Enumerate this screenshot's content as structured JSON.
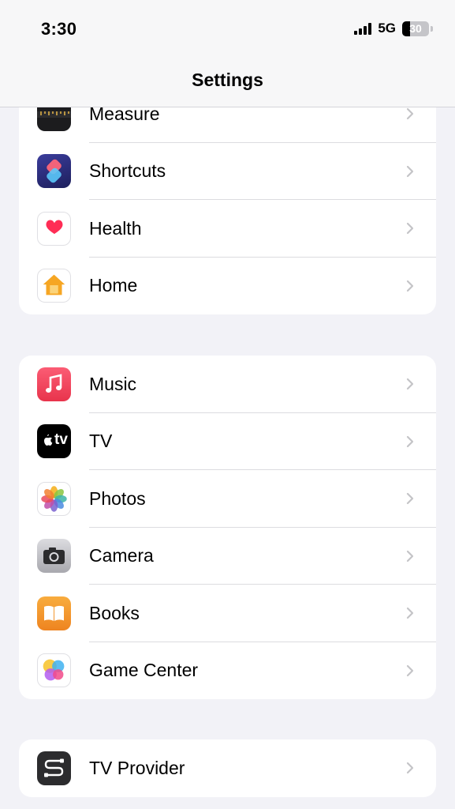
{
  "status_bar": {
    "time": "3:30",
    "network": "5G",
    "battery": "30",
    "battery_level": 0.3
  },
  "header": {
    "title": "Settings"
  },
  "groups": [
    {
      "items": [
        {
          "label": "Measure",
          "icon": "measure-icon"
        },
        {
          "label": "Shortcuts",
          "icon": "shortcuts-icon"
        },
        {
          "label": "Health",
          "icon": "health-icon"
        },
        {
          "label": "Home",
          "icon": "home-icon"
        }
      ]
    },
    {
      "items": [
        {
          "label": "Music",
          "icon": "music-icon"
        },
        {
          "label": "TV",
          "icon": "tv-icon"
        },
        {
          "label": "Photos",
          "icon": "photos-icon"
        },
        {
          "label": "Camera",
          "icon": "camera-icon"
        },
        {
          "label": "Books",
          "icon": "books-icon"
        },
        {
          "label": "Game Center",
          "icon": "game-center-icon"
        }
      ]
    },
    {
      "items": [
        {
          "label": "TV Provider",
          "icon": "tv-provider-icon"
        }
      ]
    }
  ],
  "tv_icon_text": "tv",
  "colors": {
    "background": "#f2f2f7",
    "cell": "#ffffff",
    "separator": "#dcdce0",
    "chevron": "#c4c4c7",
    "music": "#f0455a",
    "books": "#f29a34",
    "shortcuts": "#2c2e7a"
  }
}
